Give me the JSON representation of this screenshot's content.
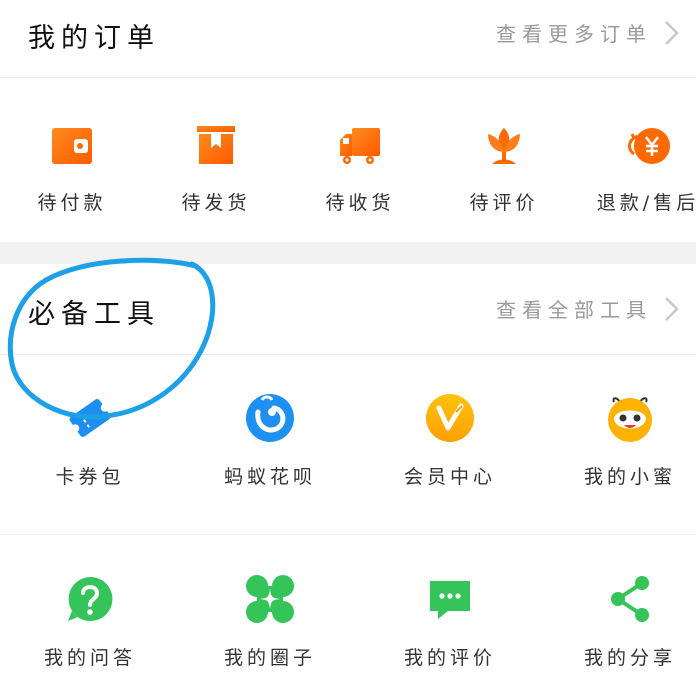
{
  "orders": {
    "title": "我的订单",
    "more": "查看更多订单",
    "items": [
      {
        "label": "待付款",
        "icon": "wallet-icon"
      },
      {
        "label": "待发货",
        "icon": "package-icon"
      },
      {
        "label": "待收货",
        "icon": "truck-icon"
      },
      {
        "label": "待评价",
        "icon": "flower-icon"
      },
      {
        "label": "退款/售后",
        "icon": "refund-yen-icon"
      }
    ]
  },
  "tools": {
    "title": "必备工具",
    "more": "查看全部工具",
    "row1": [
      {
        "label": "卡券包",
        "icon": "ticket-icon"
      },
      {
        "label": "蚂蚁花呗",
        "icon": "huabei-icon"
      },
      {
        "label": "会员中心",
        "icon": "vip-icon"
      },
      {
        "label": "我的小蜜",
        "icon": "bee-mascot-icon"
      }
    ],
    "row2": [
      {
        "label": "我的问答",
        "icon": "question-icon"
      },
      {
        "label": "我的圈子",
        "icon": "circle-icon"
      },
      {
        "label": "我的评价",
        "icon": "comment-icon"
      },
      {
        "label": "我的分享",
        "icon": "share-icon"
      }
    ]
  },
  "colors": {
    "orange": "#ff6a00",
    "green": "#35c45a",
    "blue": "#1e8ff0",
    "yellow": "#ffb300",
    "annotation": "#1ea0e6"
  }
}
